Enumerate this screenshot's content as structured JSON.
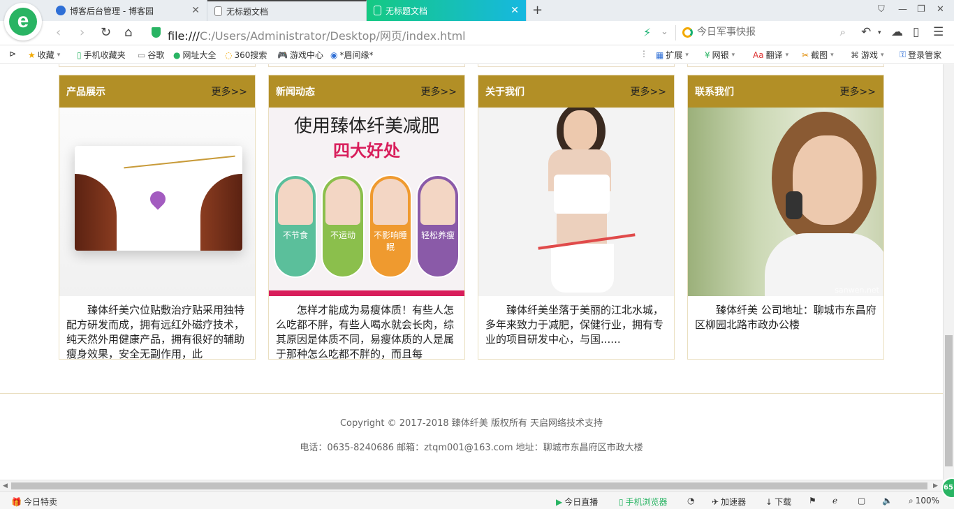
{
  "colors": {
    "accent": "#b28f26",
    "tab_active_start": "#15c982",
    "tab_active_end": "#16b8e0",
    "brand_green": "#29b463"
  },
  "browser": {
    "tabs": [
      {
        "label": "博客后台管理 - 博客园",
        "active": false
      },
      {
        "label": "无标题文档",
        "active": false
      },
      {
        "label": "无标题文档",
        "active": true
      }
    ],
    "new_tab": "+",
    "url_scheme": "file:///",
    "url_path": "C:/Users/Administrator/Desktop/网页/index.html",
    "search_placeholder": "今日军事快报"
  },
  "bookmarks": {
    "left": [
      "收藏",
      "手机收藏夹",
      "谷歌",
      "网址大全",
      "360搜索",
      "游戏中心",
      "*眉间缘*"
    ],
    "right": [
      "扩展",
      "网银",
      "翻译",
      "截图",
      "游戏",
      "登录管家"
    ]
  },
  "cards": [
    {
      "title": "产品展示",
      "more": "更多>>",
      "text": "臻体纤美穴位贴敷治疗贴采用独特配方研发而成，拥有远红外磁疗技术，纯天然外用健康产品，拥有很好的辅助瘦身效果，安全无副作用，此"
    },
    {
      "title": "新闻动态",
      "more": "更多>>",
      "text": "怎样才能成为易瘦体质！有些人怎么吃都不胖，有些人喝水就会长肉，综其原因是体质不同，易瘦体质的人是属于那种怎么吃都不胖的，而且每"
    },
    {
      "title": "关于我们",
      "more": "更多>>",
      "text": "臻体纤美坐落于美丽的江北水城，多年来致力于减肥，保健行业，拥有专业的项目研发中心，与国......"
    },
    {
      "title": "联系我们",
      "more": "更多>>",
      "text": "臻体纤美 公司地址：聊城市东昌府区柳园北路市政办公楼"
    }
  ],
  "diet_poster": {
    "headline": "使用臻体纤美减肥",
    "subhead": "四大好处",
    "benefits": [
      "不节食",
      "不运动",
      "不影响睡眠",
      "轻松养瘦"
    ]
  },
  "photo_watermark": "sanwen.net",
  "footer": {
    "copyright": "Copyright © 2017-2018 臻体纤美 版权所有    天启网络技术支持",
    "contact": "电话：0635-8240686    邮箱：ztqm001@163.com    地址：聊城市东昌府区市政大楼"
  },
  "statusbar": {
    "left": "今日特卖",
    "items": [
      "今日直播",
      "手机浏览器",
      "加速器",
      "下载"
    ],
    "zoom": "100%",
    "badge": "65"
  }
}
